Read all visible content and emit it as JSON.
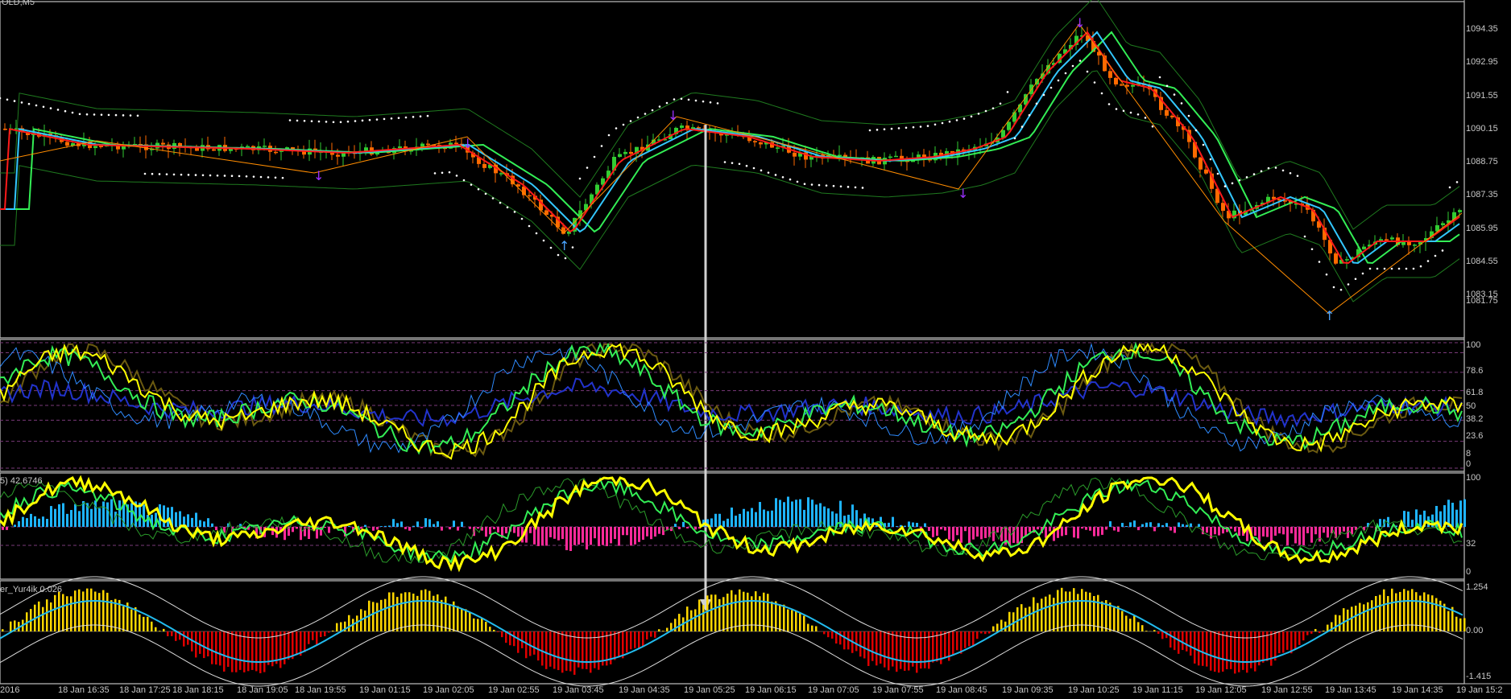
{
  "title": "OLD,M5",
  "panes": {
    "main": {
      "price_ticks": [
        "1094.35",
        "1092.95",
        "1091.55",
        "1090.15",
        "1088.75",
        "1087.35",
        "1085.95",
        "1084.55",
        "1083.15",
        "1081.75"
      ]
    },
    "stochastic": {
      "levels": [
        "100",
        "78.6",
        "61.8",
        "50",
        "38.2",
        "23.6",
        "8",
        "0"
      ]
    },
    "rsi": {
      "label": "5) 42.6746",
      "levels": [
        "100",
        "32",
        "0"
      ]
    },
    "oscillator": {
      "label": "er_Yur4ik 0.026",
      "levels": [
        "1.254",
        "0.00",
        "-1.415"
      ]
    }
  },
  "time_axis": [
    "2016",
    "18 Jan 16:35",
    "18 Jan 17:25",
    "18 Jan 18:15",
    "18 Jan 19:05",
    "18 Jan 19:55",
    "19 Jan 01:15",
    "19 Jan 02:05",
    "19 Jan 02:55",
    "19 Jan 03:45",
    "19 Jan 04:35",
    "19 Jan 05:25",
    "19 Jan 06:15",
    "19 Jan 07:05",
    "19 Jan 07:55",
    "19 Jan 08:45",
    "19 Jan 09:35",
    "19 Jan 10:25",
    "19 Jan 11:15",
    "19 Jan 12:05",
    "19 Jan 12:55",
    "19 Jan 13:45",
    "19 Jan 14:35",
    "19 Jan 15:2"
  ],
  "colors": {
    "background": "#000000",
    "frame": "#c0c0c0",
    "bull_candle": "#32cd32",
    "bear_candle": "#ff6a00",
    "ma_fast": "#ff1a1a",
    "ma_mid": "#33c7ff",
    "ma_slow": "#33ee55",
    "bollinger": "#1f7a1f",
    "zigzag": "#ff8c00",
    "arrow_up": "#4aa3ff",
    "arrow_down": "#9b30ff",
    "yellow_line": "#ffff00",
    "hist_up_blue": "#1eb4ff",
    "hist_down_pink": "#ff2a9a",
    "hist_up_yellow": "#ffd700",
    "hist_down_red": "#e00000",
    "level_dashed": "#7a3a7a"
  }
}
